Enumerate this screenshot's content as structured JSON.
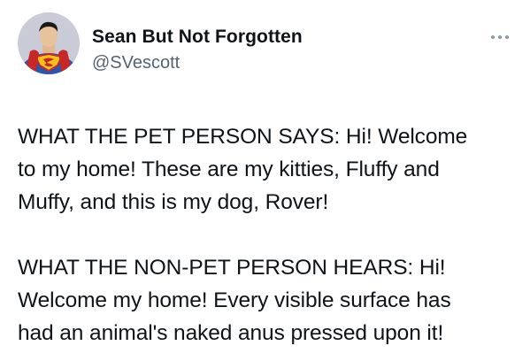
{
  "author": {
    "display_name": "Sean But Not Forgotten",
    "handle": "@SVescott",
    "avatar_icon": "superman-avatar-icon"
  },
  "menu": {
    "icon": "more-options-icon"
  },
  "tweet": {
    "paragraph_1": [
      "WHAT THE PET PERSON SAYS: Hi! Welcome",
      "to my home! These are my kitties, Fluffy and",
      "Muffy, and this is my dog, Rover!"
    ],
    "paragraph_2": [
      "WHAT THE NON-PET PERSON HEARS: Hi!",
      "Welcome my home! Every visible surface has",
      "had an animal's naked anus pressed upon it!"
    ]
  },
  "colors": {
    "text_primary": "#0f1419",
    "text_secondary": "#536471",
    "icon_gray": "#8b98a5"
  }
}
